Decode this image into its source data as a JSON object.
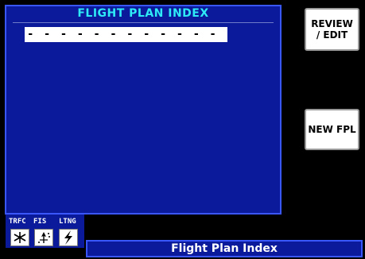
{
  "panel": {
    "title": "FLIGHT PLAN INDEX",
    "entry": "- - - - - - - - - - - - - - - -"
  },
  "softkeys": {
    "review_line1": "REVIEW",
    "review_line2": "/ EDIT",
    "new_fpl": "NEW FPL"
  },
  "status_strip": {
    "trfc_label": "TRFC",
    "fis_label": "FIS",
    "ltng_label": "LTNG",
    "icons": [
      "traffic-icon",
      "fis-weather-icon",
      "lightning-icon"
    ]
  },
  "footer": {
    "page_title": "Flight Plan Index"
  },
  "colors": {
    "background": "#000000",
    "panel_blue": "#0a1a9a",
    "panel_border": "#3a56ff",
    "title_cyan": "#2ee9f6",
    "softkey_white": "#ffffff"
  }
}
